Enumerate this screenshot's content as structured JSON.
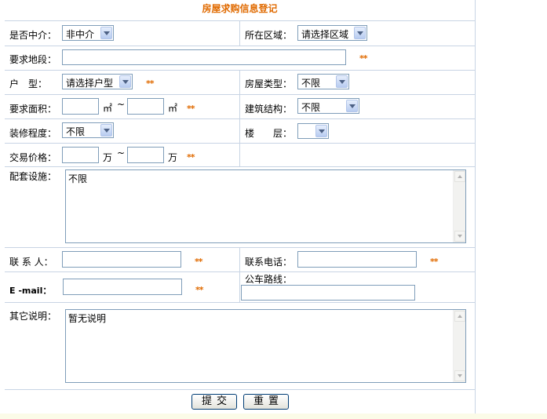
{
  "title": "房屋求购信息登记",
  "fields": {
    "agent": {
      "label": "是否中介：",
      "value": "非中介"
    },
    "region": {
      "label": "所在区域：",
      "value": "请选择区域"
    },
    "location": {
      "label": "要求地段：",
      "value": ""
    },
    "layout": {
      "label": "户　型：",
      "value": "请选择户型"
    },
    "house_type": {
      "label": "房屋类型：",
      "value": "不限"
    },
    "area": {
      "label": "要求面积：",
      "unit": "㎡",
      "separator": "~"
    },
    "structure": {
      "label": "建筑结构：",
      "value": "不限"
    },
    "decoration": {
      "label": "装修程度：",
      "value": "不限"
    },
    "floor": {
      "label": "楼　　层：",
      "value": ""
    },
    "price": {
      "label": "交易价格：",
      "unit": "万",
      "separator": "~"
    },
    "facilities": {
      "label": "配套设施：",
      "value": "不限"
    },
    "contact": {
      "label": "联 系 人：",
      "value": ""
    },
    "phone": {
      "label": "联系电话：",
      "value": ""
    },
    "email": {
      "label": "E -mail：",
      "value": ""
    },
    "bus": {
      "label": "公车路线：",
      "value": ""
    },
    "notes": {
      "label": "其它说明：",
      "value": "暂无说明"
    }
  },
  "required_mark": "**",
  "buttons": {
    "submit": "提交",
    "reset": "重置"
  }
}
